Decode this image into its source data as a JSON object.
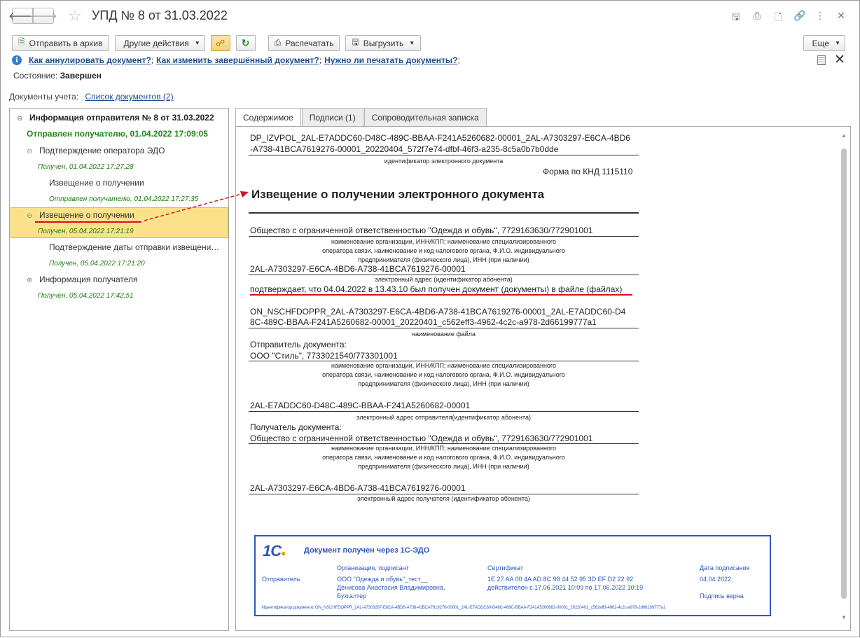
{
  "window": {
    "title": "УПД № 8 от 31.03.2022"
  },
  "toolbar": {
    "archive_label": "Отправить в архив",
    "other_actions_label": "Другие действия",
    "print_label": "Распечатать",
    "export_label": "Выгрузить",
    "more_label": "Еще"
  },
  "info": {
    "link1": "Как аннулировать документ?",
    "link2": "Как изменить завершённый документ?",
    "link3": "Нужно ли печатать документы?",
    "sep": ";"
  },
  "state": {
    "label": "Состояние:",
    "value": "Завершен"
  },
  "docs": {
    "label": "Документы учета:",
    "link": "Список документов (2)"
  },
  "tree": {
    "n1": "Информация отправителя № 8 от 31.03.2022",
    "n2": "Отправлен получателю, 01.04.2022 17:09:05",
    "n3": "Подтверждение оператора ЭДО",
    "n3s": "Получен, 01.04.2022 17:27:28",
    "n4": "Извещение о получении",
    "n4s": "Отправлен получателю, 01.04.2022 17:27:35",
    "n5": "Извещение о получении",
    "n5s": "Получен, 05.04.2022 17:21:19",
    "n6": "Подтверждение даты отправки извещени…",
    "n6s": "Получен, 05.04.2022 17:21:20",
    "n7": "Информация получателя",
    "n7s": "Получен, 05.04.2022 17:42:51"
  },
  "tabs": {
    "t1": "Содержимое",
    "t2": "Подписи (1)",
    "t3": "Сопроводительная записка"
  },
  "document": {
    "id_line1": "DP_IZVPOL_2AL-E7ADDC60-D48C-489C-BBAA-F241A5260682-00001_2AL-A7303297-E6CA-4BD6",
    "id_line2": "-A738-41BCA7619276-00001_20220404_572f7e74-dfbf-46f3-a235-8c5a0b7b0dde",
    "id_caption": "идентификатор электронного документа",
    "form_knd": "Форма по КНД 1115110",
    "heading": "Извещение о получении электронного документа",
    "org1": "Общество с ограниченной ответственностью \"Одежда и обувь\", 7729163630/772901001",
    "org_caption1": "наименование организации, ИНН/КПП; наименование специализированного",
    "org_caption2": "оператора связи, наименование и код налогового органа, Ф.И.О. индивидуального",
    "org_caption3": "предпринимателя (физического лица), ИНН (при наличии)",
    "addr1": "2AL-A7303297-E6CA-4BD6-A738-41BCA7619276-00001",
    "addr_caption1": "электронный адрес (идентификатор абонента)",
    "confirm": "подтверждает, что 04.04.2022 в 13.43.10 был получен документ (документы) в файле (файлах)",
    "file1": "ON_NSCHFDOPPR_2AL-A7303297-E6CA-4BD6-A738-41BCA7619276-00001_2AL-E7ADDC60-D4",
    "file2": "8C-489C-BBAA-F241A5260682-00001_20220401_c562eff3-4962-4c2c-a978-2d66199777a1",
    "file_caption": "наименование файла",
    "sender_label": "Отправитель документа:",
    "sender": "ООО \"Стиль\", 7733021540/773301001",
    "sender_caption1": "наименование организации, ИНН/КПП; наименование специализированного",
    "sender_caption2": "оператора связи, наименование и код налогового органа, Ф.И.О. индивидуального",
    "sender_caption3": "предпринимателя (физического лица), ИНН (при наличии)",
    "sender_addr": "2AL-E7ADDC60-D48C-489C-BBAA-F241A5260682-00001",
    "sender_addr_caption": "электронный адрес отправителя(идентификатор абонента)",
    "recipient_label": "Получатель документа:",
    "recipient": "Общество с ограниченной ответственностью \"Одежда и обувь\", 7729163630/772901001",
    "recipient_caption1": "наименование организации, ИНН/КПП; наименование специализированного",
    "recipient_caption2": "оператора связи, наименование и код налогового органа, Ф.И.О. индивидуального",
    "recipient_caption3": "предпринимателя (физического лица), ИНН (при наличии)",
    "recipient_addr": "2AL-A7303297-E6CA-4BD6-A738-41BCA7619276-00001",
    "recipient_addr_caption": "электронный адрес получателя (идентификатор абонента)"
  },
  "stamp": {
    "logo": "1С",
    "title": "Документ получен через 1С-ЭДО",
    "col_org": "Организация, подписант",
    "col_cert": "Сертификат",
    "col_date": "Дата подписания",
    "row_label": "Отправитель",
    "org1": "ООО \"Одежда и обувь\"_тест__",
    "org2": "Денисова Анастасия Владимировна,",
    "org3": "Бухгалтер",
    "cert1": "1E 27 AA 00 4A AD 8C 98 44 52 95 3D EF D2 22 92",
    "cert2": "действителен с 17.06.2021 10:09 по 17.06.2022 10:19",
    "date": "04.04.2022",
    "sig_valid": "Подпись верна",
    "doc_id": "Идентификатор документа: ON_NSCHFDOPPR_2AL-A7303297-E6CA-4BD6-A738-41BCA7619276-00001_2AL-E7ADDC60-D48C-489C-BBAA-F241A5260682-00001_20220401_c562eff3-4962-4c2c-a978-2d66199777a1"
  },
  "colors": {
    "accent_link": "#1f4c8f",
    "status_green": "#1d8a12",
    "selection": "#fbe28a",
    "annotation_red": "#d1141c",
    "stamp_blue": "#2b56c2"
  }
}
